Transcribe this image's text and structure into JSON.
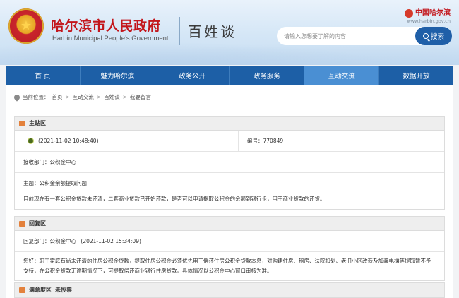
{
  "header": {
    "gov_title": "哈尔滨市人民政府",
    "gov_subtitle": "Harbin Municipal People’s Government",
    "section_title": "百姓谈",
    "site_name": "中国哈尔滨",
    "site_url": "www.harbin.gov.cn",
    "search_placeholder": "请输入您想要了解的内容",
    "search_button": "搜索"
  },
  "nav": [
    {
      "label": "首 页"
    },
    {
      "label": "魅力哈尔滨"
    },
    {
      "label": "政务公开"
    },
    {
      "label": "政务服务"
    },
    {
      "label": "互动交流"
    },
    {
      "label": "数据开放"
    }
  ],
  "breadcrumb": {
    "prefix": "当前位置：",
    "items": [
      "首页",
      "互动交流",
      "百姓谈",
      "我要留言"
    ],
    "sep": ">"
  },
  "main_post": {
    "heading": "主贴区",
    "time": "(2021-11-02 10:48:40)",
    "number_label": "编号：",
    "number": "770849",
    "dept_label": "接收部门：",
    "dept": "公积金中心",
    "subject_label": "主题：",
    "subject": "公积金余额提取问题",
    "body": "目前现在有一套公积金贷款未还清，二套商业贷款已开始还款，是否可以申请提取公积金的余额到银行卡，用于商业贷款的还贷。"
  },
  "reply": {
    "heading": "回复区",
    "dept_label": "回复部门：",
    "dept": "公积金中心",
    "time": "(2021-11-02 15:34:09)",
    "body": "您好：职工家庭有尚未还清的住房公积金贷款，提取住房公积金必须优先用于偿还住房公积金贷款本息，对购建住房、租房、法院扣划、老旧小区改造及加装电梯等提取暂不予支持，在公积金贷款无逾期情况下，可提取偿还商业银行住房贷款。具体情况以公积金中心窗口审核为准。"
  },
  "vote": {
    "heading": "满意度区",
    "status": "未投票"
  },
  "colors": {
    "nav_bg": "#1d5fa6",
    "nav_active": "#4a8fd3",
    "gov_red": "#c3161c",
    "panel_icon": "#e3813c"
  }
}
